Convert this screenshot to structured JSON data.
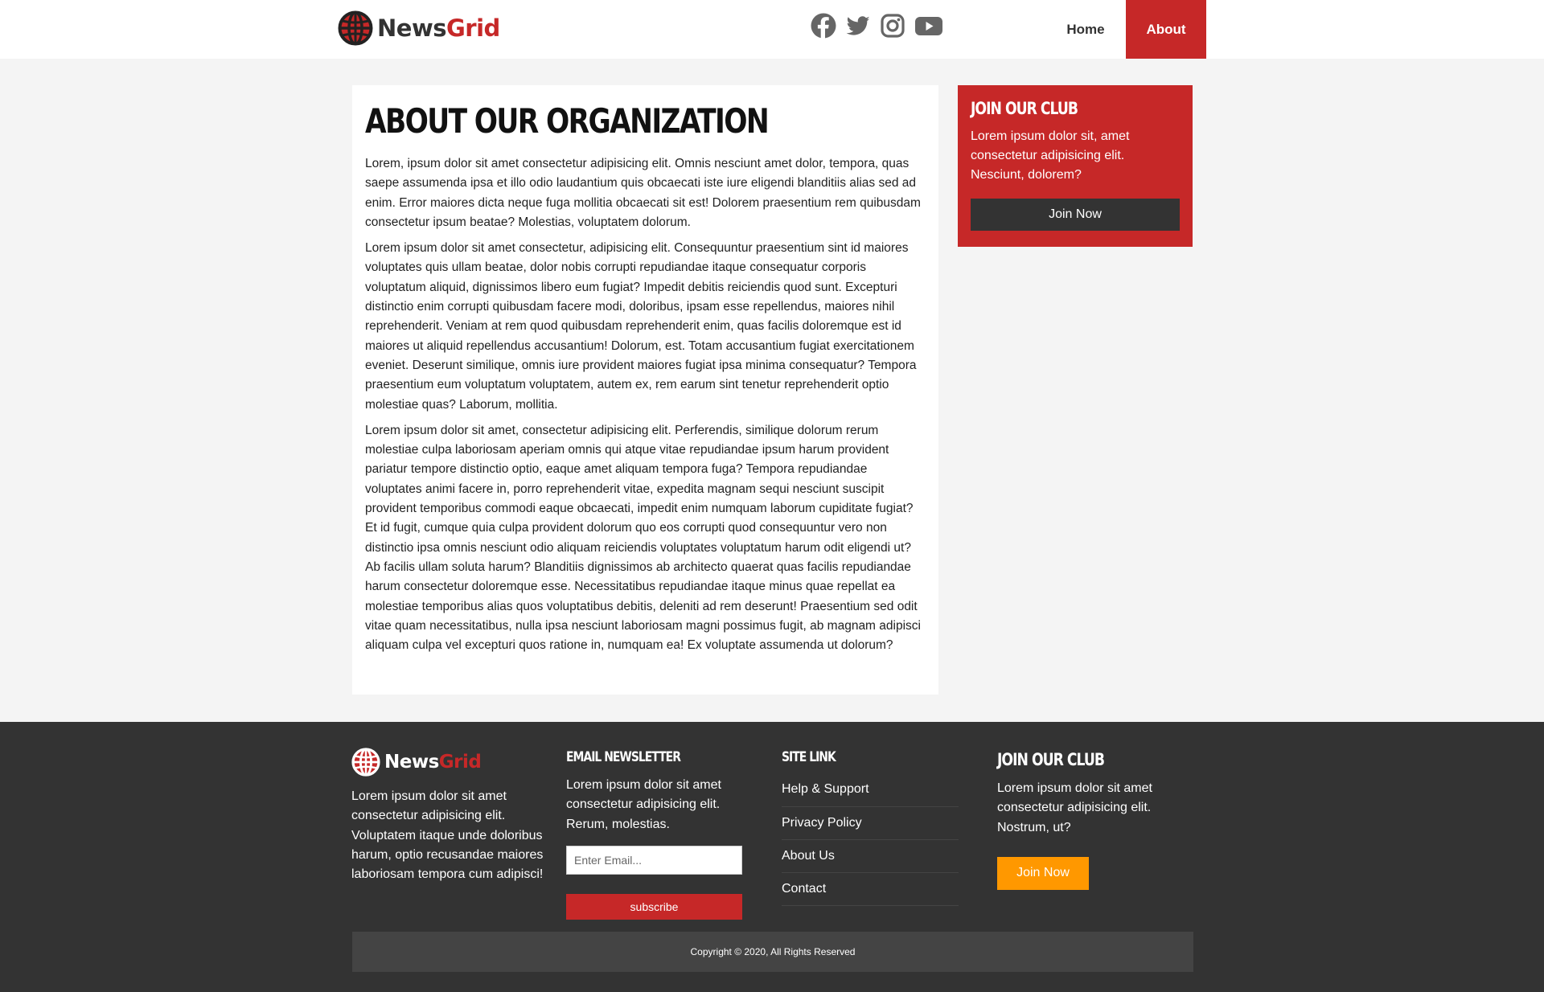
{
  "brand": {
    "name_part1": "News",
    "name_part2": "Grid",
    "accent": "#c62828"
  },
  "header": {
    "social": [
      "facebook-icon",
      "twitter-icon",
      "instagram-icon",
      "youtube-icon"
    ],
    "nav": [
      {
        "label": "Home",
        "active": false
      },
      {
        "label": "About",
        "active": true
      }
    ]
  },
  "main": {
    "title": "About Our Organization",
    "paragraphs": [
      "Lorem, ipsum dolor sit amet consectetur adipisicing elit. Omnis nesciunt amet dolor, tempora, quas saepe assumenda ipsa et illo odio laudantium quis obcaecati iste iure eligendi blanditiis alias sed ad enim. Error maiores dicta neque fuga mollitia obcaecati sit est! Dolorem praesentium rem quibusdam consectetur ipsum beatae? Molestias, voluptatem dolorum.",
      "Lorem ipsum dolor sit amet consectetur, adipisicing elit. Consequuntur praesentium sint id maiores voluptates quis ullam beatae, dolor nobis corrupti repudiandae itaque consequatur corporis voluptatum aliquid, dignissimos libero eum fugiat? Impedit debitis reiciendis quod sunt. Excepturi distinctio enim corrupti quibusdam facere modi, doloribus, ipsam esse repellendus, maiores nihil reprehenderit. Veniam at rem quod quibusdam reprehenderit enim, quas facilis doloremque est id maiores ut aliquid repellendus accusantium! Dolorum, est. Totam accusantium fugiat exercitationem eveniet. Deserunt similique, omnis iure provident maiores fugiat ipsa minima consequatur? Tempora praesentium eum voluptatum voluptatem, autem ex, rem earum sint tenetur reprehenderit optio molestiae quas? Laborum, mollitia.",
      "Lorem ipsum dolor sit amet, consectetur adipisicing elit. Perferendis, similique dolorum rerum molestiae culpa laboriosam aperiam omnis qui atque vitae repudiandae ipsum harum provident pariatur tempore distinctio optio, eaque amet aliquam tempora fuga? Tempora repudiandae voluptates animi facere in, porro reprehenderit vitae, expedita magnam sequi nesciunt suscipit provident temporibus commodi eaque obcaecati, impedit enim numquam laborum cupiditate fugiat? Et id fugit, cumque quia culpa provident dolorum quo eos corrupti quod consequuntur vero non distinctio ipsa omnis nesciunt odio aliquam reiciendis voluptates voluptatum harum odit eligendi ut? Ab facilis ullam soluta harum? Blanditiis dignissimos ab architecto quaerat quas facilis repudiandae harum consectetur doloremque esse. Necessitatibus repudiandae itaque minus quae repellat ea molestiae temporibus alias quos voluptatibus debitis, deleniti ad rem deserunt! Praesentium sed odit vitae quam necessitatibus, nulla ipsa nesciunt laboriosam magni possimus fugit, ab magnam adipisci aliquam culpa vel excepturi quos ratione in, numquam ea! Ex voluptate assumenda ut dolorum?"
    ]
  },
  "sidebar": {
    "title": "Join Our Club",
    "text": "Lorem ipsum dolor sit, amet consectetur adipisicing elit. Nesciunt, dolorem?",
    "button": "Join Now"
  },
  "footer": {
    "about": "Lorem ipsum dolor sit amet consectetur adipisicing elit. Voluptatem itaque unde doloribus harum, optio recusandae maiores laboriosam tempora cum adipisci!",
    "newsletter": {
      "title": "Email Newsletter",
      "text": "Lorem ipsum dolor sit amet consectetur adipisicing elit. Rerum, molestias.",
      "placeholder": "Enter Email...",
      "button": "subscribe"
    },
    "links": {
      "title": "Site Link",
      "items": [
        "Help & Support",
        "Privacy Policy",
        "About Us",
        "Contact"
      ]
    },
    "club": {
      "title": "Join Our Club",
      "text": "Lorem ipsum dolor sit amet consectetur adipisicing elit. Nostrum, ut?",
      "button": "Join Now",
      "button_color": "#ff9800"
    },
    "copyright": "Copyright © 2020, All Rights Reserved"
  }
}
